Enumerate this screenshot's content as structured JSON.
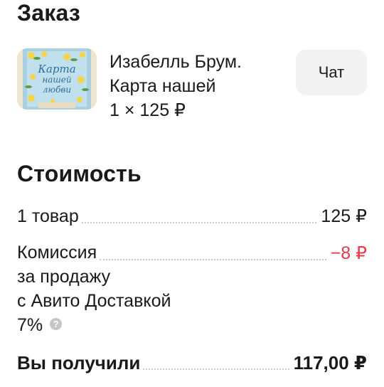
{
  "order": {
    "title": "Заказ",
    "item_title_line1": "Изабелль Брум.",
    "item_title_line2": "Карта нашей",
    "item_price": "1 × 125 ₽",
    "chat_button": "Чат",
    "thumbnail_icon": "book-cover-icon"
  },
  "cost": {
    "title": "Стоимость",
    "items_label": "1 товар",
    "items_value": "125 ₽",
    "commission_label_line1": "Комиссия",
    "commission_label_line2": "за продажу",
    "commission_label_line3": "с Авито Доставкой",
    "commission_percent": "7%",
    "commission_value": "−8 ₽",
    "help_icon": "?",
    "total_label": "Вы получили",
    "total_value": "117,00 ₽"
  },
  "colors": {
    "negative": "#e8394a",
    "chat_button_bg": "#f2f2f2",
    "help_icon_bg": "#c6c6c6"
  }
}
